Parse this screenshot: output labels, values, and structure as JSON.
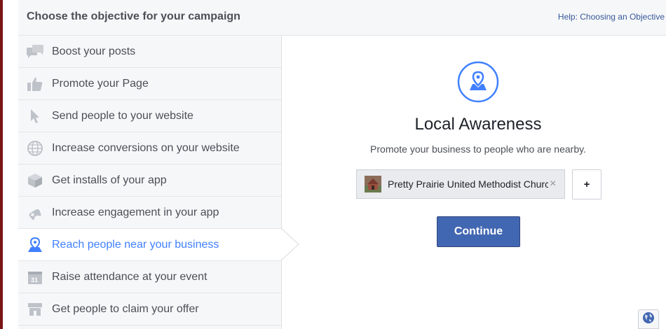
{
  "header": {
    "title": "Choose the objective for your campaign",
    "help_link": "Help: Choosing an Objective"
  },
  "sidebar": {
    "items": [
      {
        "label": "Boost your posts",
        "icon": "speech-bubbles-icon",
        "selected": false
      },
      {
        "label": "Promote your Page",
        "icon": "thumbs-up-icon",
        "selected": false
      },
      {
        "label": "Send people to your website",
        "icon": "cursor-icon",
        "selected": false
      },
      {
        "label": "Increase conversions on your website",
        "icon": "globe-icon",
        "selected": false
      },
      {
        "label": "Get installs of your app",
        "icon": "cube-icon",
        "selected": false
      },
      {
        "label": "Increase engagement in your app",
        "icon": "gamepad-icon",
        "selected": false
      },
      {
        "label": "Reach people near your business",
        "icon": "location-pin-icon",
        "selected": true
      },
      {
        "label": "Raise attendance at your event",
        "icon": "calendar-icon",
        "selected": false
      },
      {
        "label": "Get people to claim your offer",
        "icon": "storefront-icon",
        "selected": false
      }
    ]
  },
  "main": {
    "icon": "location-pin-circle-icon",
    "title": "Local Awareness",
    "description": "Promote your business to people who are nearby.",
    "page_chip": {
      "name": "Pretty Prairie United Methodist Church",
      "close": "×"
    },
    "add_button": "+",
    "continue_button": "Continue"
  },
  "footer": {
    "globe_icon": "globe-icon"
  },
  "colors": {
    "accent": "#4080ff",
    "button": "#4267b2",
    "sidebar_bg": "#f6f7f9",
    "icon_gray": "#bec2c9"
  }
}
